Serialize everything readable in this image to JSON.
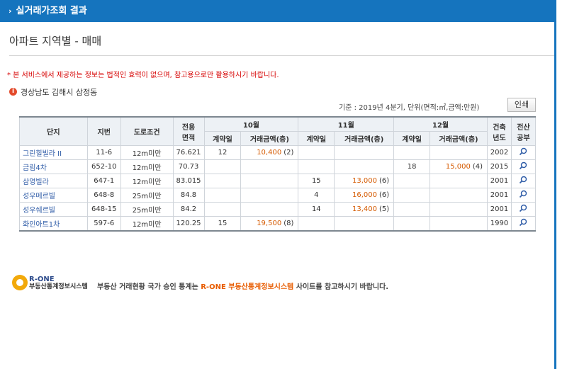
{
  "header": {
    "title": "실거래가조회 결과"
  },
  "page_title": "아파트 지역별 - 매매",
  "notice": "* 본 서비스에서 제공하는 정보는 법적인 효력이 없으며, 참고용으로만 활용하시기 바랍니다.",
  "region": "경상남도 김해시 삼정동",
  "basis": "기준 : 2019년 4분기, 단위(면적:㎡,금액:만원)",
  "print_label": "인쇄",
  "table": {
    "headers": {
      "complex": "단지",
      "lot": "지번",
      "road": "도로조건",
      "area": "전용\n면적",
      "month_10": "10월",
      "month_11": "11월",
      "month_12": "12월",
      "contract_day": "계약일",
      "amount": "거래금액(층)",
      "built": "건축\n년도",
      "ledger": "전산\n공부"
    },
    "rows": [
      {
        "name": "그린힐빌라 II",
        "lot": "11-6",
        "road": "12m미만",
        "area": "76.621",
        "m10_day": "12",
        "m10_amt": "10,400",
        "m10_floor": "(2)",
        "m11_day": "",
        "m11_amt": "",
        "m11_floor": "",
        "m12_day": "",
        "m12_amt": "",
        "m12_floor": "",
        "built": "2002"
      },
      {
        "name": "금림4차",
        "lot": "652-10",
        "road": "12m미만",
        "area": "70.73",
        "m10_day": "",
        "m10_amt": "",
        "m10_floor": "",
        "m11_day": "",
        "m11_amt": "",
        "m11_floor": "",
        "m12_day": "18",
        "m12_amt": "15,000",
        "m12_floor": "(4)",
        "built": "2015"
      },
      {
        "name": "삼영빌라",
        "lot": "647-1",
        "road": "12m미만",
        "area": "83.015",
        "m10_day": "",
        "m10_amt": "",
        "m10_floor": "",
        "m11_day": "15",
        "m11_amt": "13,000",
        "m11_floor": "(6)",
        "m12_day": "",
        "m12_amt": "",
        "m12_floor": "",
        "built": "2001"
      },
      {
        "name": "성우메르빌",
        "lot": "648-8",
        "road": "25m미만",
        "area": "84.8",
        "m10_day": "",
        "m10_amt": "",
        "m10_floor": "",
        "m11_day": "4",
        "m11_amt": "16,000",
        "m11_floor": "(6)",
        "m12_day": "",
        "m12_amt": "",
        "m12_floor": "",
        "built": "2001"
      },
      {
        "name": "성우쉐르빌",
        "lot": "648-15",
        "road": "25m미만",
        "area": "84.2",
        "m10_day": "",
        "m10_amt": "",
        "m10_floor": "",
        "m11_day": "14",
        "m11_amt": "13,400",
        "m11_floor": "(5)",
        "m12_day": "",
        "m12_amt": "",
        "m12_floor": "",
        "built": "2001"
      },
      {
        "name": "화인아트1차",
        "lot": "597-6",
        "road": "12m미만",
        "area": "120.25",
        "m10_day": "15",
        "m10_amt": "19,500",
        "m10_floor": "(8)",
        "m11_day": "",
        "m11_amt": "",
        "m11_floor": "",
        "m12_day": "",
        "m12_amt": "",
        "m12_floor": "",
        "built": "1990"
      }
    ]
  },
  "footer": {
    "logo_top": "R-ONE",
    "logo_bottom": "부동산통계정보시스템",
    "msg_before": "부동산 거래현황 국가 승인 통계는 ",
    "msg_highlight": "R-ONE 부동산통계정보시스템",
    "msg_after": " 사이트를 참고하시기 바랍니다."
  },
  "colors": {
    "header_bg": "#1574be",
    "notice": "#d60000",
    "price": "#d55a00",
    "link": "#2c5aa6"
  }
}
